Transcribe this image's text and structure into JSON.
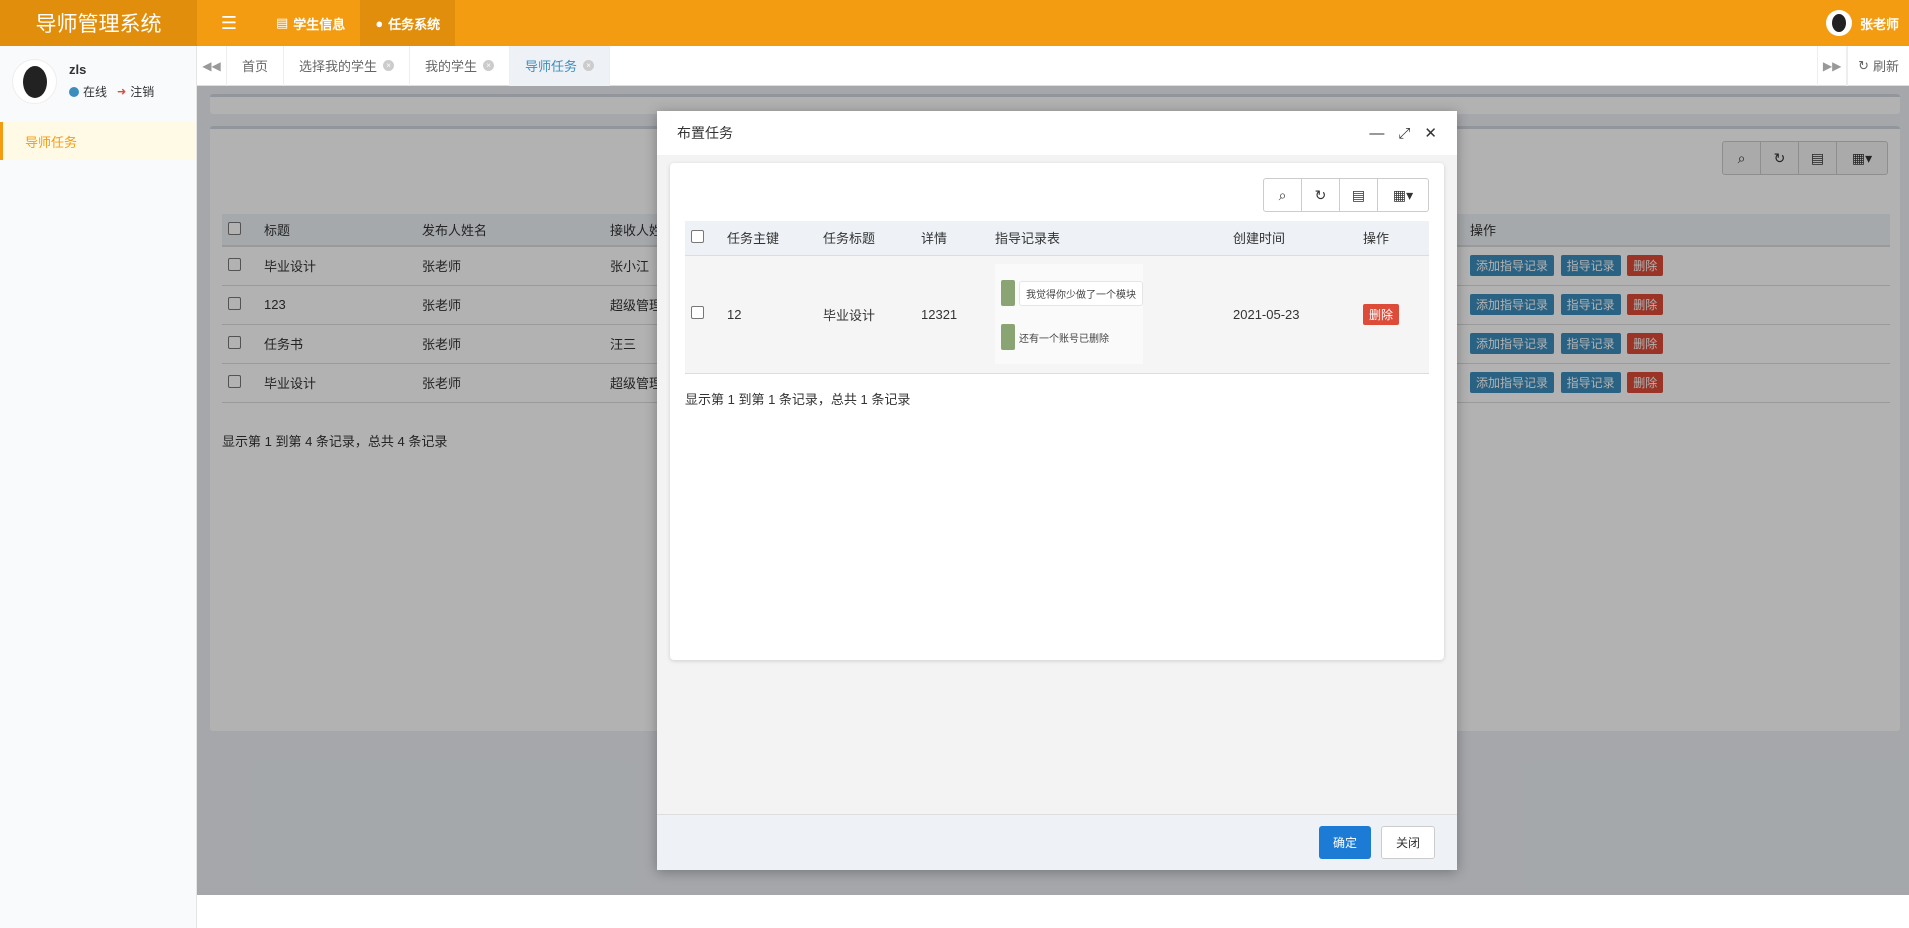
{
  "header": {
    "logo": "导师管理系统",
    "nav": [
      {
        "label": "学生信息"
      },
      {
        "label": "任务系统"
      }
    ],
    "user": "张老师"
  },
  "sidebar": {
    "username": "zls",
    "status": "在线",
    "logout": "注销",
    "menu_item": "导师任务"
  },
  "tabs": {
    "items": [
      "首页",
      "选择我的学生",
      "我的学生",
      "导师任务"
    ],
    "refresh": "刷新"
  },
  "main_table": {
    "headers": [
      "标题",
      "发布人姓名",
      "接收人姓名",
      "操作"
    ],
    "rows": [
      {
        "title": "毕业设计",
        "publisher": "张老师",
        "receiver": "张小江"
      },
      {
        "title": "123",
        "publisher": "张老师",
        "receiver": "超级管理"
      },
      {
        "title": "任务书",
        "publisher": "张老师",
        "receiver": "汪三"
      },
      {
        "title": "毕业设计",
        "publisher": "张老师",
        "receiver": "超级管理"
      }
    ],
    "actions": {
      "add": "添加指导记录",
      "guide": "指导记录",
      "delete": "删除"
    },
    "page_info": "显示第 1 到第 4 条记录，总共 4 条记录"
  },
  "modal": {
    "title": "布置任务",
    "headers": [
      "任务主键",
      "任务标题",
      "详情",
      "指导记录表",
      "创建时间",
      "操作"
    ],
    "row": {
      "id": "12",
      "title": "毕业设计",
      "detail": "12321",
      "chat1": "我觉得你少做了一个模块",
      "chat2": "还有一个账号已删除",
      "created": "2021-05-23",
      "delete": "删除"
    },
    "page_info": "显示第 1 到第 1 条记录，总共 1 条记录",
    "ok": "确定",
    "close": "关闭"
  }
}
